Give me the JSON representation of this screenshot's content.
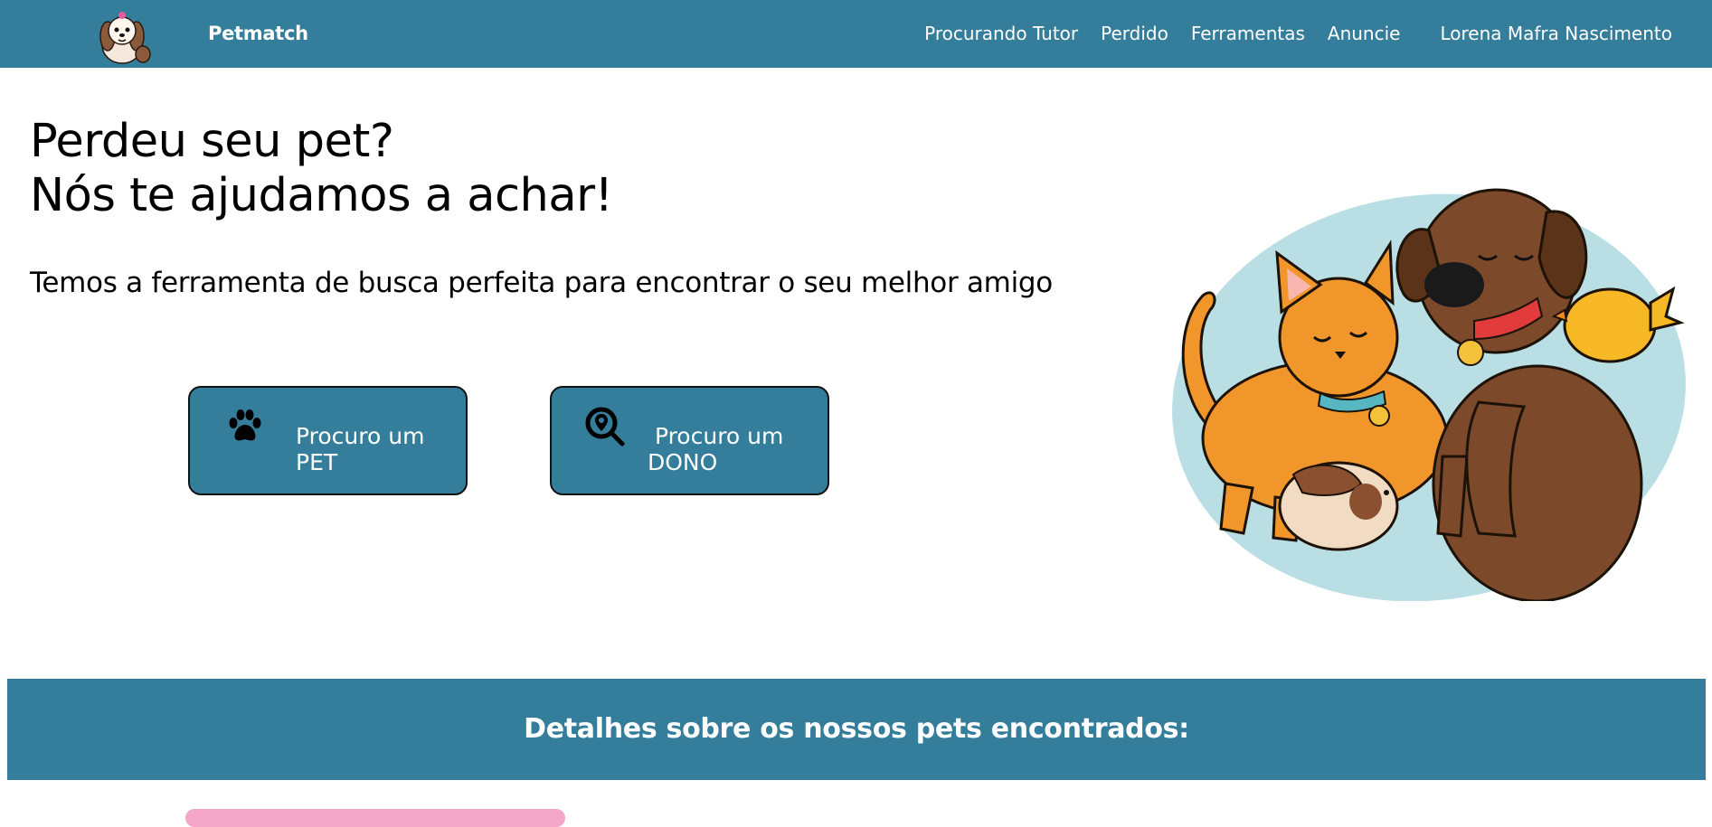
{
  "navbar": {
    "brand": "Petmatch",
    "links": [
      "Procurando Tutor",
      "Perdido",
      "Ferramentas",
      "Anuncie"
    ],
    "user_name": "Lorena Mafra Nascimento"
  },
  "hero": {
    "title_line1": "Perdeu seu pet?",
    "title_line2": "Nós te ajudamos a achar!",
    "subtitle": "Temos a ferramenta de busca perfeita para encontrar o seu melhor amigo",
    "buttons": [
      {
        "label": "Procuro um\nPET",
        "icon": "paw-icon"
      },
      {
        "label": " Procuro um\nDONO",
        "icon": "location-search-icon"
      }
    ]
  },
  "details": {
    "title": "Detalhes sobre os nossos pets encontrados:"
  },
  "colors": {
    "primary": "#347d9b",
    "illustration_bg": "#b9dfe4",
    "pink_card": "#f4a6c8"
  }
}
